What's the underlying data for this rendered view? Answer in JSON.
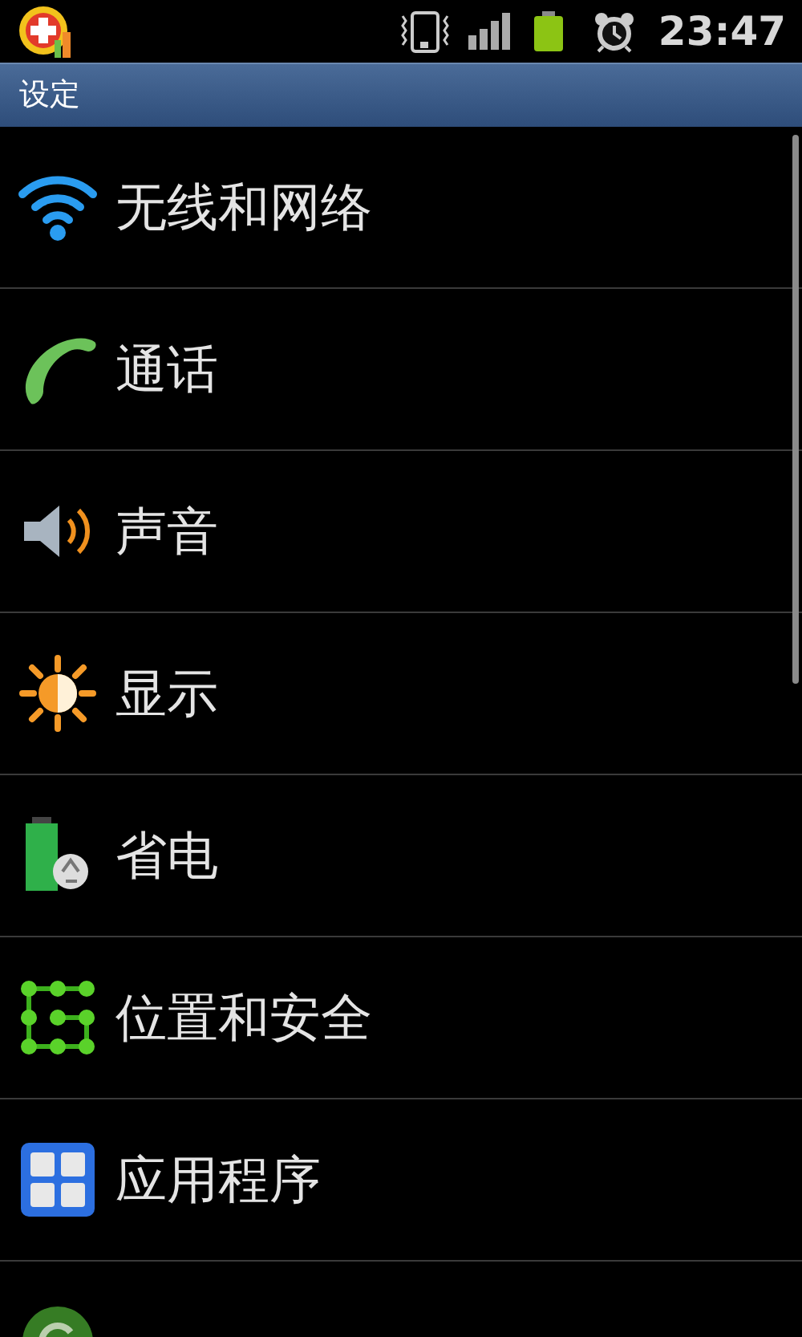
{
  "status_bar": {
    "time": "23:47"
  },
  "title_bar": {
    "title": "设定"
  },
  "settings": [
    {
      "label": "无线和网络"
    },
    {
      "label": "通话"
    },
    {
      "label": "声音"
    },
    {
      "label": "显示"
    },
    {
      "label": "省电"
    },
    {
      "label": "位置和安全"
    },
    {
      "label": "应用程序"
    },
    {
      "partial": true
    }
  ]
}
